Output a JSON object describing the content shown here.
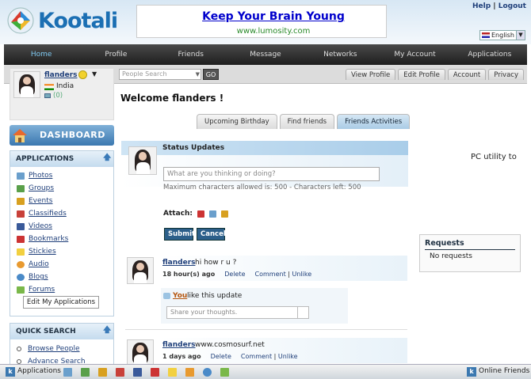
{
  "brand": {
    "name": "Kootali"
  },
  "ad": {
    "title": "Keep Your Brain Young",
    "url": "www.lumosity.com"
  },
  "toplinks": {
    "help": "Help",
    "sep": " | ",
    "logout": "Logout"
  },
  "language": {
    "selected": "English"
  },
  "nav": [
    "Home",
    "Profile",
    "Friends",
    "Message",
    "Networks",
    "My Account",
    "Applications"
  ],
  "search": {
    "placeholder": "People Search",
    "go": "GO"
  },
  "profile_tabs": [
    "View Profile",
    "Edit Profile",
    "Account",
    "Privacy"
  ],
  "profile": {
    "name": "flanders",
    "country": "India",
    "messages": "(0)"
  },
  "dashboard": {
    "label": "DASHBOARD"
  },
  "applications": {
    "title": "APPLICATIONS",
    "items": [
      "Photos",
      "Groups",
      "Events",
      "Classifieds",
      "Videos",
      "Bookmarks",
      "Stickies",
      "Audio",
      "Blogs",
      "Forums"
    ],
    "edit": "Edit My Applications"
  },
  "quick_search": {
    "title": "QUICK SEARCH",
    "items": [
      "Browse People",
      "Advance Search"
    ]
  },
  "main": {
    "welcome": "Welcome flanders !",
    "tabs": [
      "Upcoming Birthday",
      "Find friends",
      "Friends Activities"
    ],
    "status": {
      "title": "Status Updates",
      "placeholder": "What are you thinking or doing?",
      "maxchars": "Maximum characters allowed is: 500 - Characters left: 500",
      "attach": "Attach:",
      "submit": "Submit",
      "cancel": "Cancel"
    },
    "posts": [
      {
        "name": "flanders",
        "text": "hi how r u ?",
        "time": "18 hour(s) ago",
        "delete": "Delete",
        "comment": "Comment",
        "sep": "|",
        "like": "Unlike"
      },
      {
        "name": "flanders",
        "text": "www.cosmosurf.net",
        "time": "1 days ago",
        "delete": "Delete",
        "comment": "Comment",
        "sep": "|",
        "like": "Unlike"
      }
    ],
    "like": {
      "you": "You",
      "text": "like this update",
      "share_placeholder": "Share your thoughts."
    }
  },
  "right": {
    "pc_text": "PC utility to",
    "requests": {
      "title": "Requests",
      "none": "No requests"
    }
  },
  "bottombar": {
    "applications": "Applications",
    "online": "Online Friends"
  },
  "colors": {
    "accent": "#3b78b0",
    "nav_bg": "#1e1e1e",
    "nav_active": "#7ec8f0",
    "button": "#2c5f8a"
  }
}
